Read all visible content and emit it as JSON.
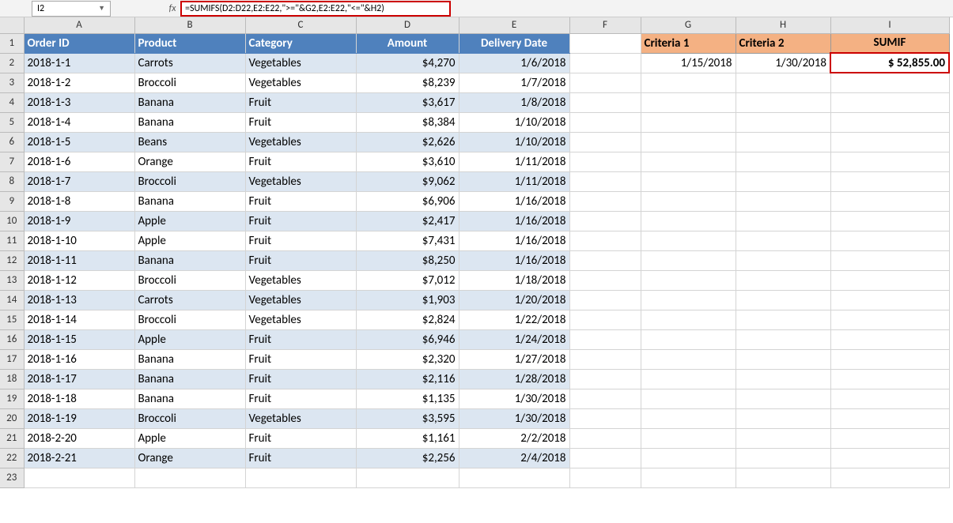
{
  "name_box": "I2",
  "fx_label": "fx",
  "formula": "=SUMIFS(D2:D22,E2:E22,\">=\"&G2,E2:E22,\"<=\"&H2)",
  "columns": [
    "A",
    "B",
    "C",
    "D",
    "E",
    "F",
    "G",
    "H",
    "I"
  ],
  "col_classes": [
    "cA",
    "cB",
    "cC",
    "cD",
    "cE",
    "cF",
    "cG",
    "cH",
    "cI"
  ],
  "row_count_visible": 23,
  "table_headers": {
    "A": "Order ID",
    "B": "Product",
    "C": "Category",
    "D": "Amount",
    "E": "Delivery Date"
  },
  "criteria_headers": {
    "G": "Criteria 1",
    "H": "Criteria 2",
    "I": "SUMIF"
  },
  "criteria_values": {
    "G": "1/15/2018",
    "H": "1/30/2018",
    "I": "$   52,855.00"
  },
  "rows": [
    {
      "A": "2018-1-1",
      "B": "Carrots",
      "C": "Vegetables",
      "D": "$4,270",
      "E": "1/6/2018"
    },
    {
      "A": "2018-1-2",
      "B": "Broccoli",
      "C": "Vegetables",
      "D": "$8,239",
      "E": "1/7/2018"
    },
    {
      "A": "2018-1-3",
      "B": "Banana",
      "C": "Fruit",
      "D": "$3,617",
      "E": "1/8/2018"
    },
    {
      "A": "2018-1-4",
      "B": "Banana",
      "C": "Fruit",
      "D": "$8,384",
      "E": "1/10/2018"
    },
    {
      "A": "2018-1-5",
      "B": "Beans",
      "C": "Vegetables",
      "D": "$2,626",
      "E": "1/10/2018"
    },
    {
      "A": "2018-1-6",
      "B": "Orange",
      "C": "Fruit",
      "D": "$3,610",
      "E": "1/11/2018"
    },
    {
      "A": "2018-1-7",
      "B": "Broccoli",
      "C": "Vegetables",
      "D": "$9,062",
      "E": "1/11/2018"
    },
    {
      "A": "2018-1-8",
      "B": "Banana",
      "C": "Fruit",
      "D": "$6,906",
      "E": "1/16/2018"
    },
    {
      "A": "2018-1-9",
      "B": "Apple",
      "C": "Fruit",
      "D": "$2,417",
      "E": "1/16/2018"
    },
    {
      "A": "2018-1-10",
      "B": "Apple",
      "C": "Fruit",
      "D": "$7,431",
      "E": "1/16/2018"
    },
    {
      "A": "2018-1-11",
      "B": "Banana",
      "C": "Fruit",
      "D": "$8,250",
      "E": "1/16/2018"
    },
    {
      "A": "2018-1-12",
      "B": "Broccoli",
      "C": "Vegetables",
      "D": "$7,012",
      "E": "1/18/2018"
    },
    {
      "A": "2018-1-13",
      "B": "Carrots",
      "C": "Vegetables",
      "D": "$1,903",
      "E": "1/20/2018"
    },
    {
      "A": "2018-1-14",
      "B": "Broccoli",
      "C": "Vegetables",
      "D": "$2,824",
      "E": "1/22/2018"
    },
    {
      "A": "2018-1-15",
      "B": "Apple",
      "C": "Fruit",
      "D": "$6,946",
      "E": "1/24/2018"
    },
    {
      "A": "2018-1-16",
      "B": "Banana",
      "C": "Fruit",
      "D": "$2,320",
      "E": "1/27/2018"
    },
    {
      "A": "2018-1-17",
      "B": "Banana",
      "C": "Fruit",
      "D": "$2,116",
      "E": "1/28/2018"
    },
    {
      "A": "2018-1-18",
      "B": "Banana",
      "C": "Fruit",
      "D": "$1,135",
      "E": "1/30/2018"
    },
    {
      "A": "2018-1-19",
      "B": "Broccoli",
      "C": "Vegetables",
      "D": "$3,595",
      "E": "1/30/2018"
    },
    {
      "A": "2018-2-20",
      "B": "Apple",
      "C": "Fruit",
      "D": "$1,161",
      "E": "2/2/2018"
    },
    {
      "A": "2018-2-21",
      "B": "Orange",
      "C": "Fruit",
      "D": "$2,256",
      "E": "2/4/2018"
    }
  ]
}
